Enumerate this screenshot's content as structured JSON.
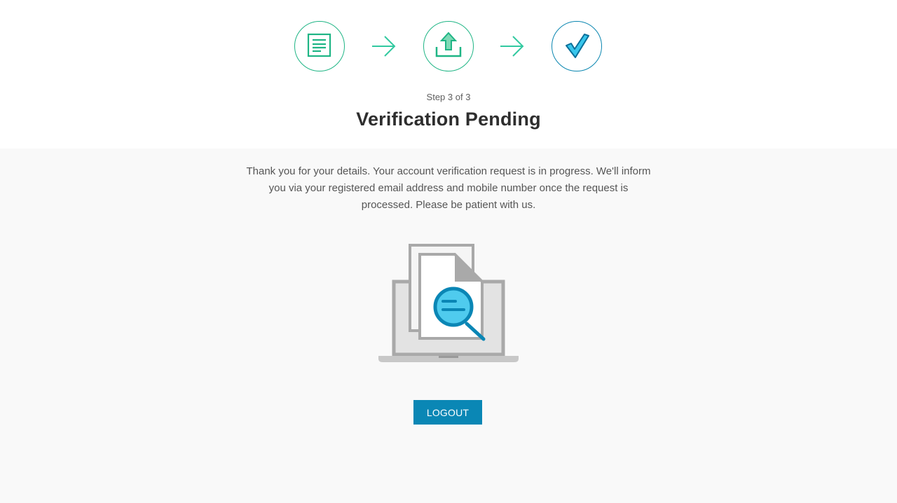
{
  "steps": {
    "items": [
      {
        "icon": "document-form-icon",
        "state": "completed"
      },
      {
        "icon": "upload-icon",
        "state": "completed"
      },
      {
        "icon": "checkmark-icon",
        "state": "current"
      }
    ],
    "connector_icon": "arrow-right-icon",
    "counter": "Step 3 of 3"
  },
  "page": {
    "title": "Verification Pending",
    "message": "Thank you for your details. Your account verification request is in progress. We'll inform you via your registered email address and mobile number once the request is processed. Please be patient with us.",
    "illustration_icon": "laptop-document-search-icon"
  },
  "actions": {
    "logout_label": "LOGOUT"
  },
  "colors": {
    "step_green": "#1fb585",
    "step_blue": "#0a86b0",
    "button_bg": "#0a87b5",
    "title_text": "#2e2e2e",
    "body_text": "#555555",
    "page_bg_top": "#ffffff",
    "page_bg_bottom": "#f9f9f9"
  }
}
